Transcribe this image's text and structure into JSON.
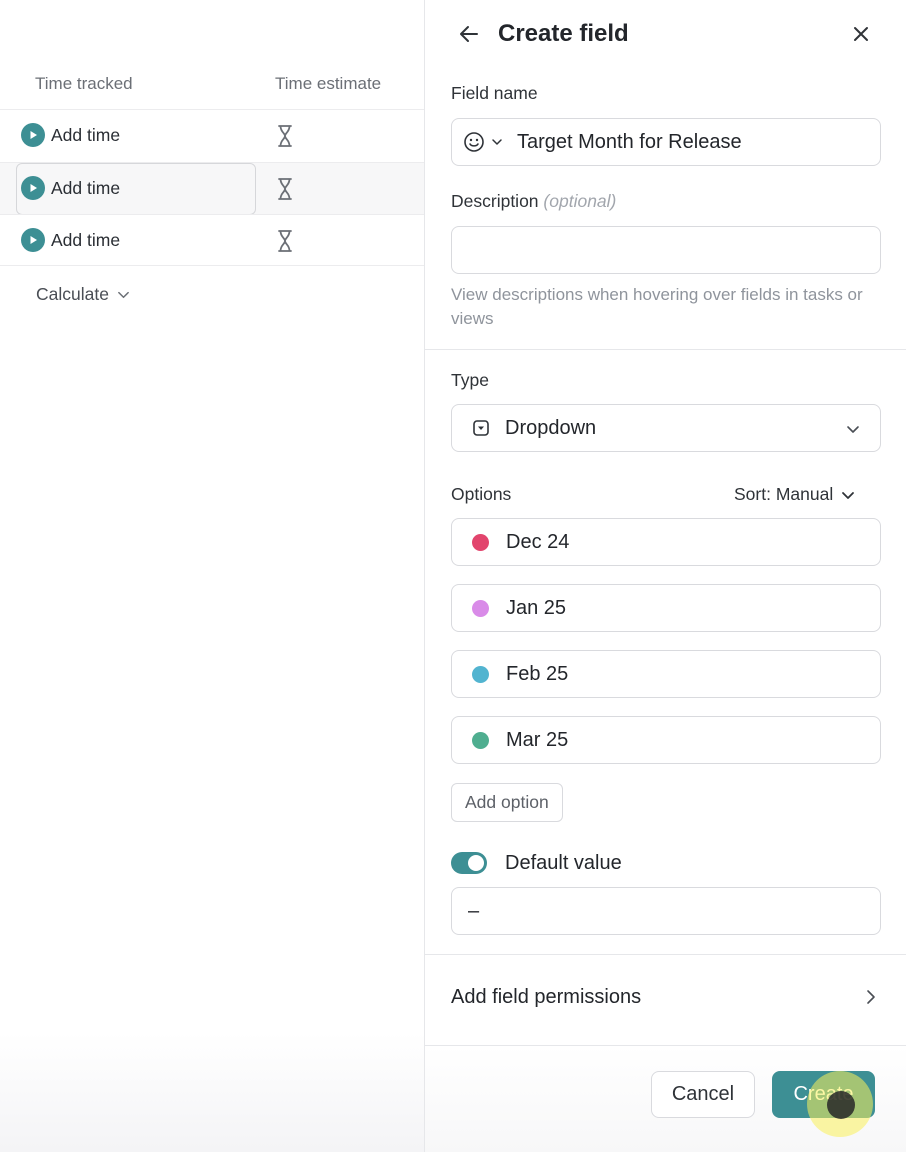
{
  "table": {
    "headers": {
      "time_tracked": "Time tracked",
      "time_estimate": "Time estimate"
    },
    "rows": [
      {
        "action": "Add time"
      },
      {
        "action": "Add time"
      },
      {
        "action": "Add time"
      }
    ],
    "calculate_label": "Calculate"
  },
  "panel": {
    "title": "Create field",
    "field_name": {
      "label": "Field name",
      "value": "Target Month for Release"
    },
    "description": {
      "label": "Description",
      "optional": "(optional)",
      "value": "",
      "helper": "View descriptions when hovering over fields in tasks or views"
    },
    "type": {
      "label": "Type",
      "value": "Dropdown"
    },
    "options": {
      "label": "Options",
      "sort_label": "Sort: Manual",
      "items": [
        {
          "label": "Dec 24",
          "color": "#e2456d"
        },
        {
          "label": "Jan 25",
          "color": "#d98be8"
        },
        {
          "label": "Feb 25",
          "color": "#52b4d0"
        },
        {
          "label": "Mar 25",
          "color": "#4fae90"
        }
      ],
      "add_label": "Add option"
    },
    "default_value": {
      "label": "Default value",
      "enabled": true,
      "value": "–"
    },
    "permissions_label": "Add field permissions",
    "cancel_label": "Cancel",
    "create_label": "Create"
  },
  "colors": {
    "accent": "#3d8f94"
  }
}
